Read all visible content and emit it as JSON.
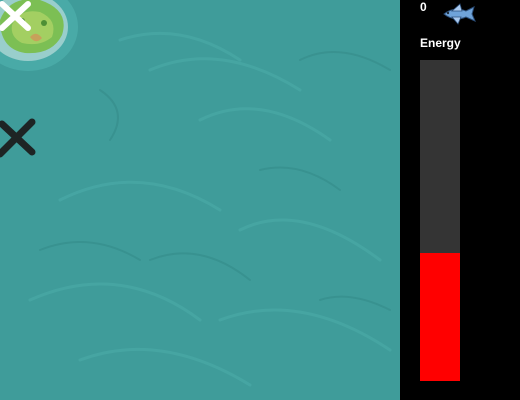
{
  "hud": {
    "score": "0",
    "energy_label": "Energy",
    "energy_level": 0.4,
    "energy_color": "#ff0000",
    "energy_empty_color": "#343434"
  },
  "icons": {
    "player": "flying-fish-icon",
    "island": "island-icon",
    "target_white": "white-x-marker-icon",
    "target_black": "black-x-marker-icon"
  },
  "colors": {
    "sea": "#3f9c9a",
    "panel": "#000000"
  }
}
